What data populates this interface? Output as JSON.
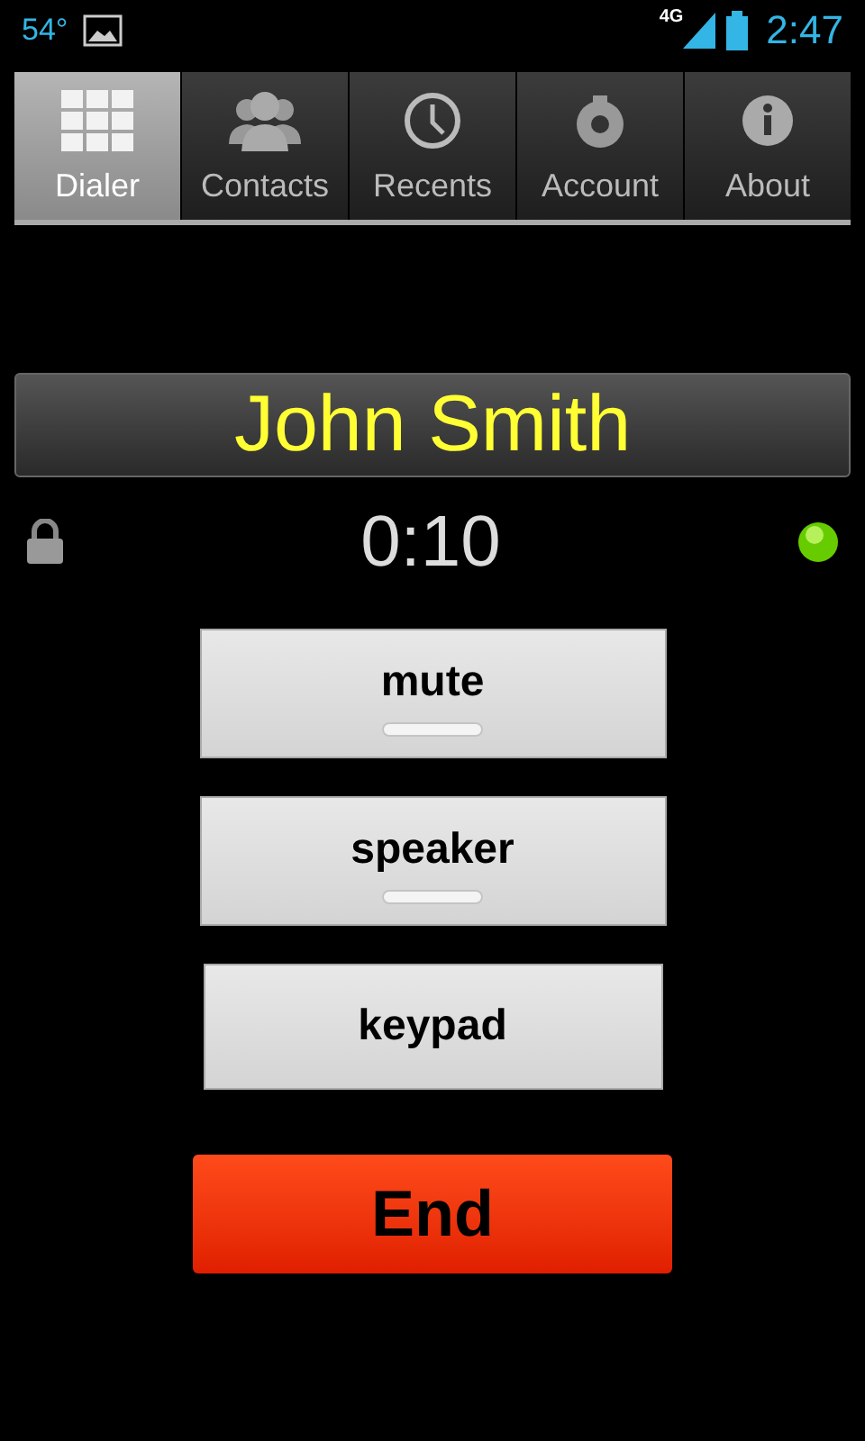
{
  "status_bar": {
    "temperature": "54°",
    "network": "4G",
    "time": "2:47"
  },
  "tabs": [
    {
      "label": "Dialer",
      "selected": true
    },
    {
      "label": "Contacts",
      "selected": false
    },
    {
      "label": "Recents",
      "selected": false
    },
    {
      "label": "Account",
      "selected": false
    },
    {
      "label": "About",
      "selected": false
    }
  ],
  "call": {
    "name": "John Smith",
    "duration": "0:10"
  },
  "controls": [
    {
      "kind": "toggle",
      "label": "mute",
      "on": false
    },
    {
      "kind": "toggle",
      "label": "speaker",
      "on": false
    },
    {
      "kind": "button",
      "label": "keypad"
    }
  ],
  "end_button": {
    "label": "End"
  }
}
